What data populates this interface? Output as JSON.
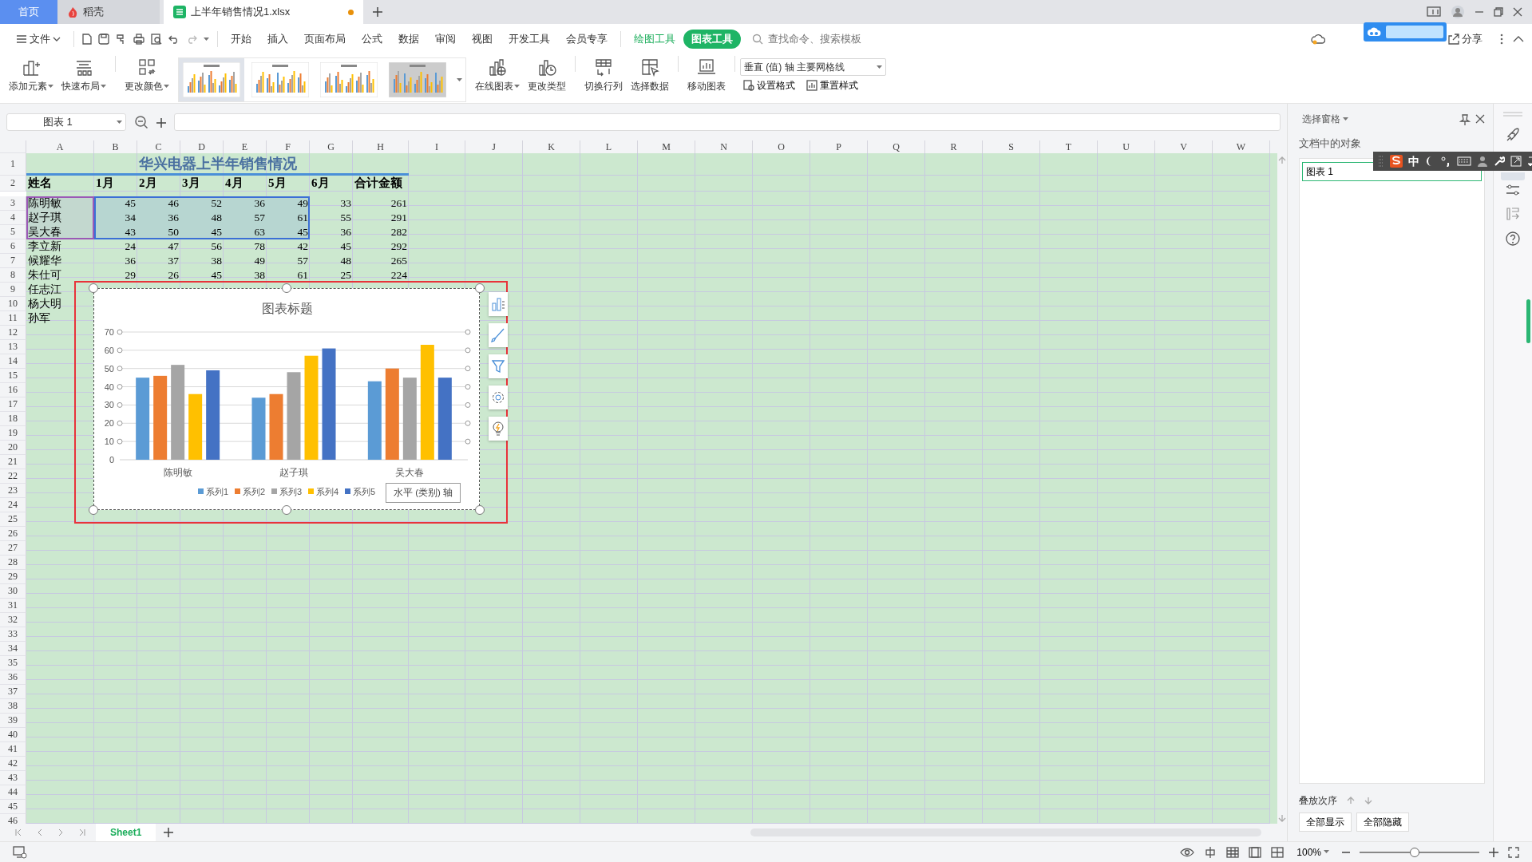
{
  "tabs": [
    {
      "label": "首页",
      "kind": "home",
      "selected": false
    },
    {
      "label": "稻壳",
      "kind": "docer",
      "selected": false
    },
    {
      "label": "上半年销售情况1.xlsx",
      "kind": "sheet",
      "selected": true,
      "modified": true
    }
  ],
  "file_menu": {
    "label": "文件"
  },
  "menu": [
    {
      "label": "开始",
      "kind": "tab",
      "selected": false
    },
    {
      "label": "插入",
      "kind": "tab",
      "selected": false
    },
    {
      "label": "页面布局",
      "kind": "tab",
      "selected": false
    },
    {
      "label": "公式",
      "kind": "tab",
      "selected": false
    },
    {
      "label": "数据",
      "kind": "tab",
      "selected": false
    },
    {
      "label": "审阅",
      "kind": "tab",
      "selected": false
    },
    {
      "label": "视图",
      "kind": "tab",
      "selected": false
    },
    {
      "label": "开发工具",
      "kind": "tab",
      "selected": false
    },
    {
      "label": "会员专享",
      "kind": "tab",
      "selected": false
    },
    {
      "label": "绘图工具",
      "kind": "context",
      "selected": false
    },
    {
      "label": "图表工具",
      "kind": "context",
      "selected": true
    }
  ],
  "search": {
    "placeholder": "查找命令、搜索模板"
  },
  "share": {
    "label": "分享"
  },
  "ribbon_left": [
    {
      "label": "添加元素",
      "dropdown": true
    },
    {
      "label": "快速布局",
      "dropdown": true
    },
    {
      "label": "更改颜色",
      "dropdown": true
    }
  ],
  "chart_styles": [
    {
      "selected": true
    },
    {
      "selected": false
    },
    {
      "selected": false
    },
    {
      "selected": false
    }
  ],
  "ribbon_right": [
    {
      "label": "在线图表",
      "dropdown": true
    },
    {
      "label": "更改类型",
      "dropdown": false
    },
    {
      "label": "切换行列",
      "dropdown": false
    },
    {
      "label": "选择数据",
      "dropdown": false
    },
    {
      "label": "移动图表",
      "dropdown": false
    }
  ],
  "element_dropdown": {
    "value": "垂直 (值) 轴 主要网格线"
  },
  "format_buttons": [
    {
      "label": "设置格式"
    },
    {
      "label": "重置样式"
    }
  ],
  "name_box": {
    "value": "图表 1"
  },
  "columns": [
    "A",
    "B",
    "C",
    "D",
    "E",
    "F",
    "G",
    "H",
    "I",
    "J",
    "K",
    "L",
    "M",
    "N",
    "O",
    "P",
    "Q",
    "R",
    "S",
    "T",
    "U",
    "V",
    "W"
  ],
  "rows": [
    {
      "number": "1",
      "title": "华兴电器上半年销售情况"
    },
    {
      "number": "2",
      "header": true,
      "cells": [
        "姓名",
        "1月",
        "2月",
        "3月",
        "4月",
        "5月",
        "6月",
        "合计金额"
      ]
    },
    {
      "number": "3",
      "in_series": true,
      "cells": [
        "陈明敏",
        "45",
        "46",
        "52",
        "36",
        "49",
        "33",
        "261"
      ]
    },
    {
      "number": "4",
      "in_series": true,
      "cells": [
        "赵子琪",
        "34",
        "36",
        "48",
        "57",
        "61",
        "55",
        "291"
      ]
    },
    {
      "number": "5",
      "in_series": true,
      "cells": [
        "吴大春",
        "43",
        "50",
        "45",
        "63",
        "45",
        "36",
        "282"
      ]
    },
    {
      "number": "6",
      "cells": [
        "李立新",
        "24",
        "47",
        "56",
        "78",
        "42",
        "45",
        "292"
      ]
    },
    {
      "number": "7",
      "cells": [
        "候耀华",
        "36",
        "37",
        "38",
        "49",
        "57",
        "48",
        "265"
      ]
    },
    {
      "number": "8",
      "cells": [
        "朱仕可",
        "29",
        "26",
        "45",
        "38",
        "61",
        "25",
        "224"
      ]
    },
    {
      "number": "9",
      "cells": [
        "任志江"
      ]
    },
    {
      "number": "10",
      "cells": [
        "杨大明"
      ]
    },
    {
      "number": "11",
      "cells": [
        "孙军"
      ]
    },
    {
      "number": "12"
    },
    {
      "number": "13"
    },
    {
      "number": "14"
    },
    {
      "number": "15"
    },
    {
      "number": "16"
    },
    {
      "number": "17"
    },
    {
      "number": "18"
    },
    {
      "number": "19"
    },
    {
      "number": "20"
    },
    {
      "number": "21"
    },
    {
      "number": "22"
    },
    {
      "number": "23"
    },
    {
      "number": "24"
    },
    {
      "number": "25"
    },
    {
      "number": "26"
    },
    {
      "number": "27"
    },
    {
      "number": "28"
    },
    {
      "number": "29"
    },
    {
      "number": "30"
    },
    {
      "number": "31"
    },
    {
      "number": "32"
    },
    {
      "number": "33"
    },
    {
      "number": "34"
    },
    {
      "number": "35"
    },
    {
      "number": "36"
    },
    {
      "number": "37"
    },
    {
      "number": "38"
    },
    {
      "number": "39"
    },
    {
      "number": "40"
    },
    {
      "number": "41"
    },
    {
      "number": "42"
    },
    {
      "number": "43"
    },
    {
      "number": "44"
    },
    {
      "number": "45"
    },
    {
      "number": "46"
    }
  ],
  "chart": {
    "tooltip": "水平 (类别) 轴",
    "chart_data": {
      "type": "bar",
      "title": "图表标题",
      "categories": [
        "陈明敏",
        "赵子琪",
        "吴大春"
      ],
      "series": [
        {
          "name": "系列1",
          "color": "#5b9bd5",
          "values": [
            45,
            34,
            43
          ]
        },
        {
          "name": "系列2",
          "color": "#ed7d31",
          "values": [
            46,
            36,
            50
          ]
        },
        {
          "name": "系列3",
          "color": "#a5a5a5",
          "values": [
            52,
            48,
            45
          ]
        },
        {
          "name": "系列4",
          "color": "#ffc000",
          "values": [
            36,
            57,
            63
          ]
        },
        {
          "name": "系列5",
          "color": "#4472c4",
          "values": [
            49,
            61,
            45
          ]
        }
      ],
      "grid": true,
      "legend": "bottom",
      "ylim": [
        0,
        70
      ],
      "yticks": [
        {
          "value": 0,
          "label": "0"
        },
        {
          "value": 10,
          "label": "10"
        },
        {
          "value": 20,
          "label": "20"
        },
        {
          "value": 30,
          "label": "30"
        },
        {
          "value": 40,
          "label": "40"
        },
        {
          "value": 50,
          "label": "50"
        },
        {
          "value": 60,
          "label": "60"
        },
        {
          "value": 70,
          "label": "70"
        }
      ]
    }
  },
  "ime_toolbar": {
    "mode": "中"
  },
  "selection_pane": {
    "title": "选择窗格",
    "section": "文档中的对象",
    "objects": [
      {
        "label": "图表 1",
        "selected": true
      }
    ],
    "order_label": "叠放次序",
    "buttons": [
      "全部显示",
      "全部隐藏"
    ]
  },
  "sheet_tabs": [
    {
      "label": "Sheet1",
      "selected": true
    }
  ],
  "status_bar": {
    "zoom": "100%",
    "level": 0.46
  }
}
